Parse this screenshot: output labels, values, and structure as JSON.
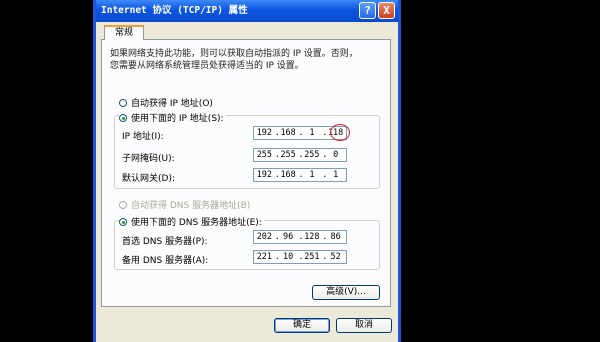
{
  "window": {
    "title": "Internet 协议 (TCP/IP) 属性",
    "help_label": "?",
    "close_label": "X"
  },
  "tab": {
    "label": "常规"
  },
  "description": "如果网络支持此功能，则可以获取自动指派的 IP 设置。否则，您需要从网络系统管理员处获得适当的 IP 设置。",
  "ip_mode": {
    "auto_label": "自动获得 IP 地址(O)",
    "manual_label": "使用下面的 IP 地址(S):",
    "selected": "manual"
  },
  "ip_fields": [
    {
      "label": "IP 地址(I):",
      "octets": [
        "192",
        "168",
        "1",
        "118"
      ]
    },
    {
      "label": "子网掩码(U):",
      "octets": [
        "255",
        "255",
        "255",
        "0"
      ]
    },
    {
      "label": "默认网关(D):",
      "octets": [
        "192",
        "168",
        "1",
        "1"
      ]
    }
  ],
  "dns_mode": {
    "auto_label": "自动获得 DNS 服务器地址(B)",
    "manual_label": "使用下面的 DNS 服务器地址(E):",
    "selected": "manual"
  },
  "dns_fields": [
    {
      "label": "首选 DNS 服务器(P):",
      "octets": [
        "202",
        "96",
        "128",
        "86"
      ]
    },
    {
      "label": "备用 DNS 服务器(A):",
      "octets": [
        "221",
        "10",
        "251",
        "52"
      ]
    }
  ],
  "buttons": {
    "advanced": "高级(V)...",
    "ok": "确定",
    "cancel": "取消"
  },
  "colors": {
    "titlebar": "#0c55e0",
    "dialog_bg": "#ece9d8",
    "highlight_circle": "#e02020"
  }
}
